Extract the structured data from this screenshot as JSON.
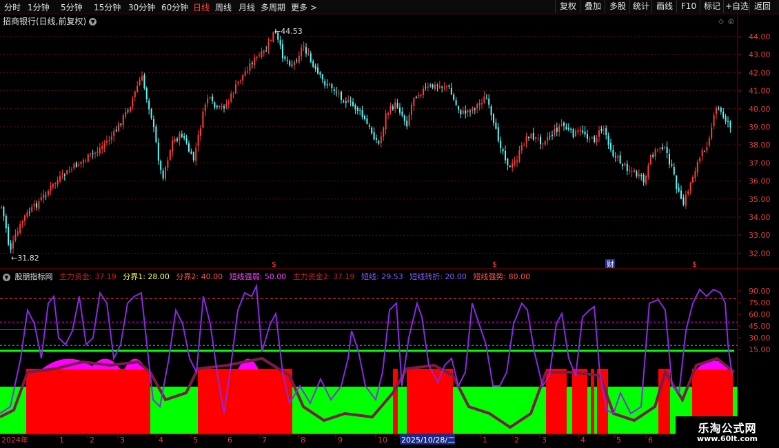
{
  "toolbar": {
    "periods": [
      "分时",
      "1分钟",
      "5分钟",
      "15分钟",
      "30分钟",
      "60分钟",
      "日线",
      "周线",
      "月线",
      "多周期",
      "更多 >"
    ],
    "active_period": "日线",
    "right_buttons": [
      "复权",
      "叠加",
      "多股",
      "统计",
      "画线",
      "F10",
      "标记",
      "+自选",
      "返回"
    ]
  },
  "main_chart": {
    "title": "招商银行(日线,前复权)",
    "high_label": "44.53",
    "low_label": "31.82",
    "markers": [
      "$",
      "$",
      "财",
      "$"
    ],
    "y_ticks": [
      "44.00",
      "43.00",
      "42.00",
      "41.00",
      "40.00",
      "39.00",
      "38.00",
      "37.00",
      "36.00",
      "35.00",
      "34.00",
      "33.00",
      "32.00"
    ],
    "colors": {
      "up": "#ff3c3c",
      "down": "#54fcfc",
      "grid": "#6a1010",
      "axis": "#8b0000"
    }
  },
  "indicator": {
    "name": "股朋指标网",
    "legend": [
      {
        "name": "主力资金",
        "value": "37.19",
        "color": "#cc2020"
      },
      {
        "name": "分界1",
        "value": "28.00",
        "color": "#ffff55"
      },
      {
        "name": "分界2",
        "value": "40.00",
        "color": "#ff5050"
      },
      {
        "name": "短线强弱",
        "value": "50.00",
        "color": "#ff40ff"
      },
      {
        "name": "主力资金2",
        "value": "37.19",
        "color": "#cc2020"
      },
      {
        "name": "短线",
        "value": "29.53",
        "color": "#8a5cff"
      },
      {
        "name": "短线转折",
        "value": "20.00",
        "color": "#8a5cff"
      },
      {
        "name": "短线强势",
        "value": "80.00",
        "color": "#ff5050"
      }
    ],
    "y_ticks": [
      "90.00",
      "75.00",
      "60.00",
      "45.00",
      "30.00",
      "15.00"
    ],
    "colors": {
      "green": "#00ff00",
      "red": "#ff0000",
      "magenta": "#ff00ff",
      "purple": "#8a2be2",
      "maroon": "#7a1c4a"
    }
  },
  "time_axis": {
    "labels": [
      "2024年",
      "1",
      "2",
      "3",
      "4",
      "5",
      "6",
      "7",
      "8",
      "9",
      "10",
      "2025/10/28/二",
      "1",
      "2",
      "3",
      "4",
      "5",
      "6"
    ]
  },
  "watermark": {
    "title": "乐淘公式网",
    "url": "www.60lt.com"
  }
}
